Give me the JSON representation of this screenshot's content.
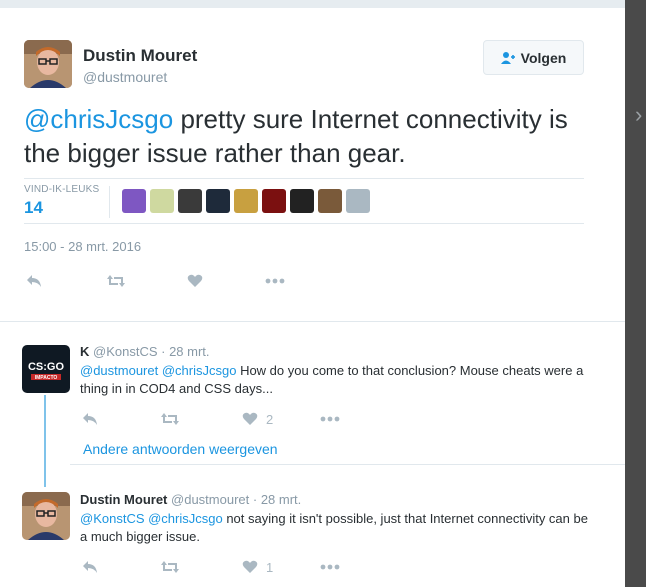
{
  "main_tweet": {
    "author_name": "Dustin Mouret",
    "author_handle": "@dustmouret",
    "follow_label": "Volgen",
    "text_mention": "@chrisJcsgo",
    "text_body": " pretty sure Internet connectivity is the bigger issue rather than gear.",
    "likes_label": "VIND-IK-LEUKS",
    "likes_count": "14",
    "timestamp": "15:00 - 28 mrt. 2016",
    "liker_colors": [
      "#7e57c2",
      "#cfd9a0",
      "#3a3a3a",
      "#1e2a3a",
      "#c8a040",
      "#7b1010",
      "#222222",
      "#7a5a3a",
      "#aab8c2"
    ]
  },
  "replies": [
    {
      "author_name": "K",
      "author_handle": "@KonstCS",
      "time": "28 mrt.",
      "mentions": "@dustmouret @chrisJcsgo",
      "body": " How do you come to that conclusion? Mouse cheats were a thing in in COD4 and CSS days...",
      "like_count": "2",
      "avatar_text": "CS:GO",
      "avatar_subtext": "IMPACTO"
    },
    {
      "author_name": "Dustin Mouret",
      "author_handle": "@dustmouret",
      "time": "28 mrt.",
      "mentions": "@KonstCS @chrisJcsgo",
      "body": " not saying it isn't possible, just that Internet connectivity can be a much bigger issue.",
      "like_count": "1"
    }
  ],
  "more_replies_label": "Andere antwoorden weergeven",
  "separator": " · ",
  "colors": {
    "link": "#1b95e0",
    "muted": "#8899a6",
    "thread": "#7fc3ea"
  }
}
